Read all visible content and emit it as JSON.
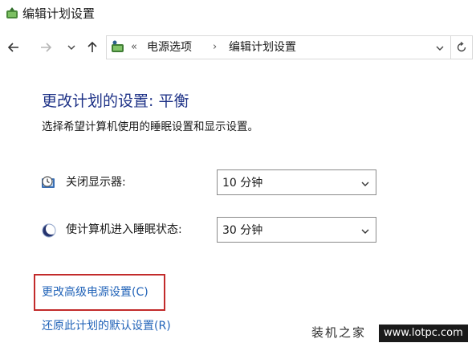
{
  "window": {
    "title": "编辑计划设置"
  },
  "nav": {
    "icons": [
      "back-arrow-icon",
      "forward-arrow-icon",
      "recent-chevron-icon",
      "up-arrow-icon"
    ],
    "address": {
      "overflow": "«",
      "crumbs": [
        "电源选项",
        "编辑计划设置"
      ],
      "separator": "›"
    }
  },
  "content": {
    "title": "更改计划的设置: 平衡",
    "description": "选择希望计算机使用的睡眠设置和显示设置。",
    "settings": [
      {
        "label": "关闭显示器:",
        "value": "10 分钟",
        "icon": "monitor-clock-icon"
      },
      {
        "label": "使计算机进入睡眠状态:",
        "value": "30 分钟",
        "icon": "moon-sleep-icon"
      }
    ],
    "links": {
      "advanced": "更改高级电源设置(C)",
      "restore": "还原此计划的默认设置(R)"
    }
  },
  "watermark": {
    "text": "装机之家",
    "url": "www.lotpc.com"
  },
  "colors": {
    "title": "#1e3287",
    "link": "#2163b8",
    "highlight": "#c22b2b"
  }
}
